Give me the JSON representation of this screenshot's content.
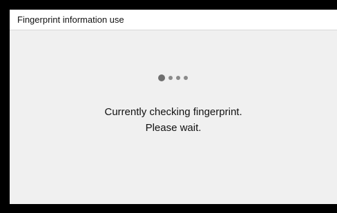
{
  "dialog": {
    "title": "Fingerprint information use"
  },
  "progress": {
    "dot_count": 4,
    "active_index": 0
  },
  "message": {
    "line1": "Currently checking fingerprint.",
    "line2": "Please wait."
  },
  "colors": {
    "background": "#000000",
    "panel": "#f0f0f0",
    "titlebar": "#ffffff",
    "dot": "#8a8a8a",
    "dot_active": "#6f6f6f",
    "text": "#111111"
  }
}
